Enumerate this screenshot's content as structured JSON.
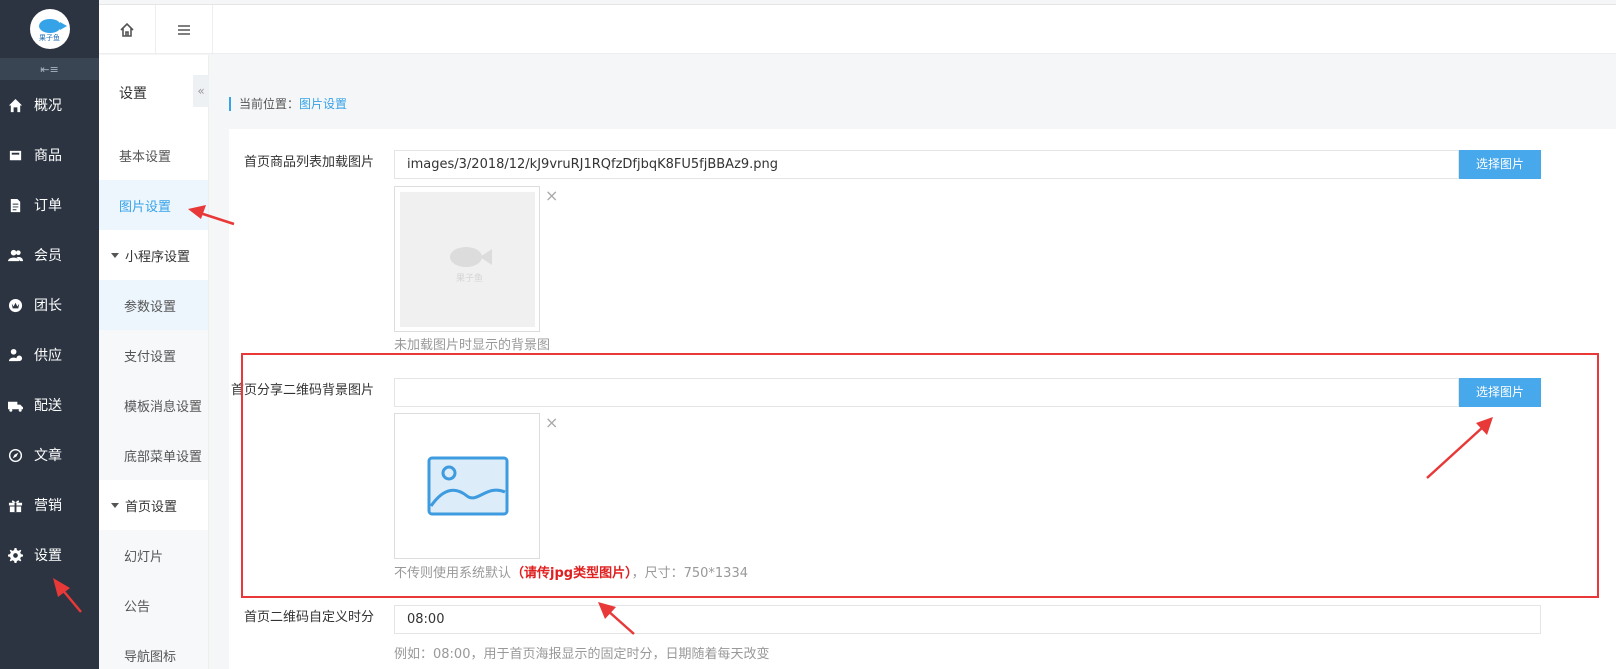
{
  "app": {
    "logo_text": "果子鱼",
    "brand_color": "#36a3e8",
    "sidebar_bg": "#2b3440"
  },
  "sidebar": {
    "collapse_icon": "collapse-icon",
    "items": [
      {
        "label": "概况",
        "icon": "home-icon"
      },
      {
        "label": "商品",
        "icon": "goods-icon"
      },
      {
        "label": "订单",
        "icon": "order-icon"
      },
      {
        "label": "会员",
        "icon": "member-icon"
      },
      {
        "label": "团长",
        "icon": "crown-icon"
      },
      {
        "label": "供应",
        "icon": "supply-icon"
      },
      {
        "label": "配送",
        "icon": "truck-icon"
      },
      {
        "label": "文章",
        "icon": "compass-icon"
      },
      {
        "label": "营销",
        "icon": "gift-icon"
      },
      {
        "label": "设置",
        "icon": "gear-icon"
      }
    ]
  },
  "subnav": {
    "title": "设置",
    "toggle": "«",
    "items": {
      "basic": "基本设置",
      "image": "图片设置",
      "mini_group": "小程序设置",
      "params": "参数设置",
      "pay": "支付设置",
      "template_msg": "模板消息设置",
      "bottom_menu": "底部菜单设置",
      "home_group": "首页设置",
      "slides": "幻灯片",
      "notice": "公告",
      "nav_icon": "导航图标"
    }
  },
  "breadcrumb": {
    "prefix": "当前位置：",
    "current": "图片设置"
  },
  "form": {
    "loading_image": {
      "label": "首页商品列表加载图片",
      "value": "images/3/2018/12/kJ9vruRJ1RQfzDfjbqK8FU5fjBBAz9.png",
      "button": "选择图片",
      "remove": "×",
      "help": "未加载图片时显示的背景图"
    },
    "share_qr_bg": {
      "label": "首页分享二维码背景图片",
      "value": "",
      "button": "选择图片",
      "remove": "×",
      "help_prefix": "不传则使用系统默认",
      "help_warn": "（请传jpg类型图片）",
      "help_suffix": "，尺寸：750*1334"
    },
    "qr_time": {
      "label": "首页二维码自定义时分",
      "value": "08:00",
      "help": "例如：08:00，用于首页海报显示的固定时分，日期随着每天改变"
    }
  },
  "annotation_color": "#e83838"
}
